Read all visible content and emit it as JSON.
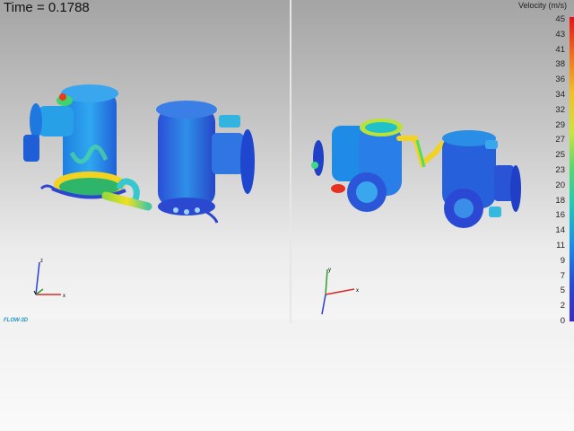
{
  "time_label": "Time = ",
  "time_value": "0.1788",
  "legend": {
    "title": "Velocity (m/s)",
    "ticks": [
      "45",
      "43",
      "41",
      "38",
      "36",
      "34",
      "32",
      "29",
      "27",
      "25",
      "23",
      "20",
      "18",
      "16",
      "14",
      "11",
      "9",
      "7",
      "5",
      "2",
      "0"
    ]
  },
  "logo_text": "FLOW-3D",
  "axes": {
    "x": "x",
    "y": "y",
    "z": "z"
  },
  "colors": {
    "high": "#e8101a",
    "mid": "#f4c020",
    "low_mid": "#1ec9b5",
    "low": "#3b2bc0",
    "body": "#2a86e8"
  }
}
